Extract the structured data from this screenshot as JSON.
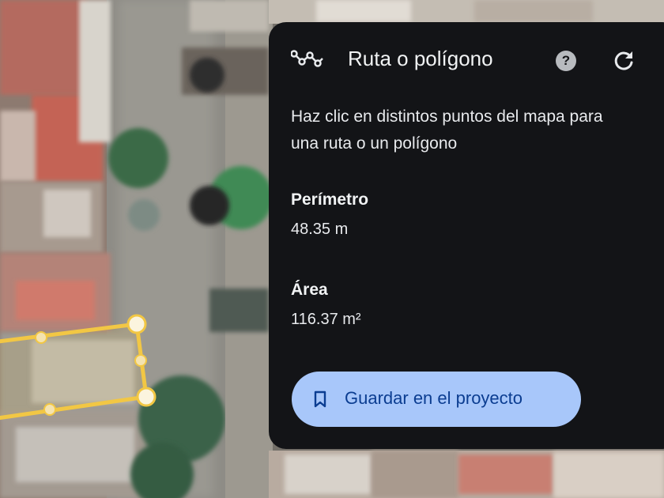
{
  "map": {
    "imagery": "satellite",
    "drawing_tool_active": true,
    "polygon": {
      "vertex_count": 4,
      "color": "#f2c744"
    }
  },
  "panel": {
    "title": "Ruta o polígono",
    "title_icon": "route-polygon-icon",
    "help_label": "?",
    "help_icon": "help-icon",
    "refresh_icon": "refresh-icon",
    "instructions_line1": "Haz clic en distintos puntos del mapa para",
    "instructions_line2": "una ruta o un polígono",
    "perimeter": {
      "label": "Perímetro",
      "value": "48.35 m"
    },
    "area": {
      "label": "Área",
      "value": "116.37 m²"
    },
    "save_button": {
      "label": "Guardar en el proyecto",
      "icon": "bookmark-icon",
      "color": "#a8c7fa"
    },
    "background_color": "#131417"
  }
}
